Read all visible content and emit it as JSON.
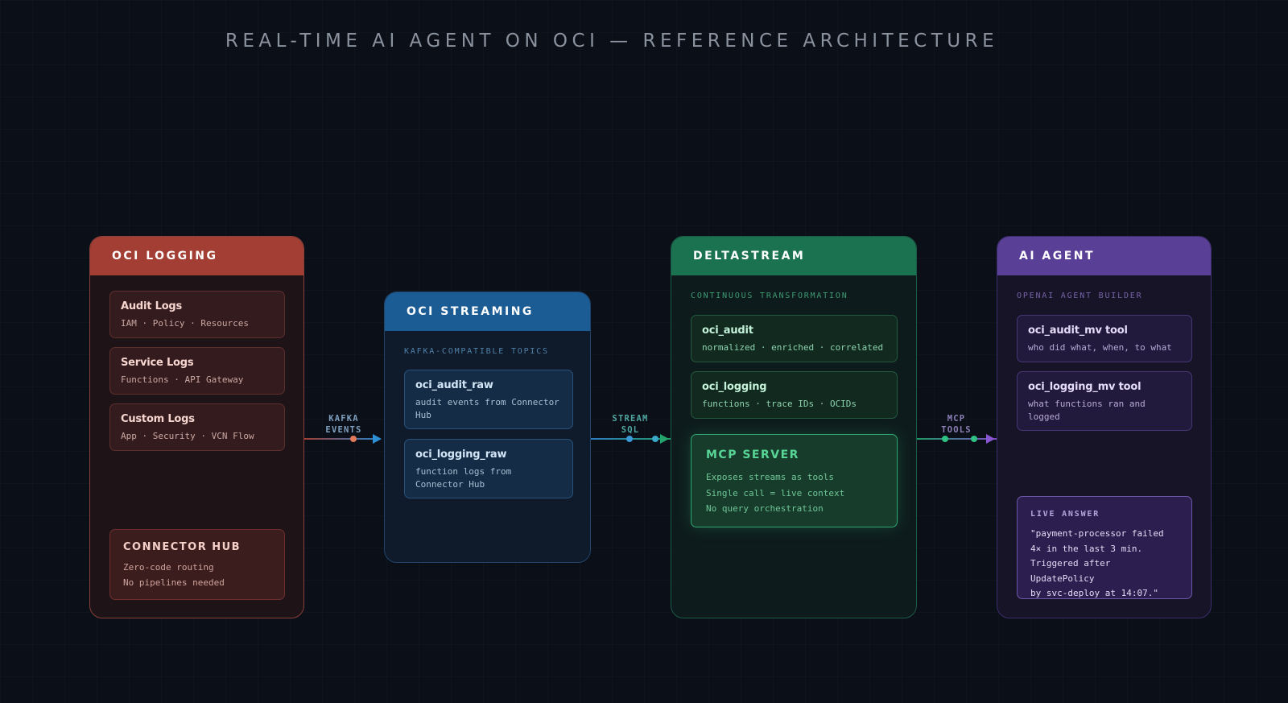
{
  "title": "REAL-TIME AI AGENT ON OCI — REFERENCE ARCHITECTURE",
  "panels": {
    "logging": {
      "header": "OCI LOGGING",
      "cards": [
        {
          "title": "Audit Logs",
          "sub": "IAM · Policy · Resources"
        },
        {
          "title": "Service Logs",
          "sub": "Functions · API Gateway"
        },
        {
          "title": "Custom Logs",
          "sub": "App · Security · VCN Flow"
        }
      ],
      "hub": {
        "title": "CONNECTOR HUB",
        "line1": "Zero-code routing",
        "line2": "No pipelines needed"
      }
    },
    "streaming": {
      "header": "OCI STREAMING",
      "section": "KAFKA-COMPATIBLE TOPICS",
      "cards": [
        {
          "title": "oci_audit_raw",
          "sub": "audit events from Connector Hub"
        },
        {
          "title": "oci_logging_raw",
          "sub": "function logs from Connector Hub"
        }
      ]
    },
    "deltastream": {
      "header": "DELTASTREAM",
      "section": "CONTINUOUS TRANSFORMATION",
      "cards": [
        {
          "title": "oci_audit",
          "sub": "normalized · enriched · correlated"
        },
        {
          "title": "oci_logging",
          "sub": "functions · trace IDs · OCIDs"
        }
      ],
      "mcp": {
        "title": "MCP SERVER",
        "line1": "Exposes streams as tools",
        "line2": "Single call = live context",
        "line3": "No query orchestration"
      }
    },
    "agent": {
      "header": "AI AGENT",
      "section": "OPENAI AGENT BUILDER",
      "cards": [
        {
          "title": "oci_audit_mv tool",
          "sub": "who did what, when, to what"
        },
        {
          "title": "oci_logging_mv tool",
          "sub": "what functions ran and logged"
        }
      ],
      "live": {
        "label": "LIVE ANSWER",
        "line1": "\"payment-processor failed",
        "line2": "4× in the last 3 min.",
        "line3": "Triggered after UpdatePolicy",
        "line4": "by svc-deploy at 14:07.\""
      }
    }
  },
  "connectors": {
    "kafka": {
      "line1": "KAFKA",
      "line2": "EVENTS"
    },
    "stream": {
      "line1": "STREAM",
      "line2": "SQL"
    },
    "mcp": {
      "line1": "MCP",
      "line2": "TOOLS"
    }
  },
  "colors": {
    "logging": "#a23e33",
    "streaming": "#1c5c94",
    "deltastream": "#1a7251",
    "agent": "#5a3f96"
  }
}
